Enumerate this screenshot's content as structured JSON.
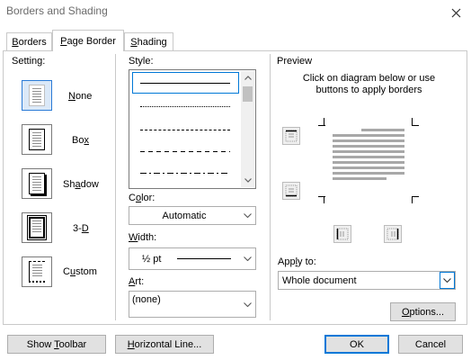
{
  "window": {
    "title": "Borders and Shading"
  },
  "tabs": [
    {
      "label": "Borders",
      "accesskey": "B",
      "rest": "orders"
    },
    {
      "label": "Page Border",
      "accesskey": "P",
      "rest": "age Border"
    },
    {
      "label": "Shading",
      "accesskey": "S",
      "rest": "hading"
    }
  ],
  "setting": {
    "label": "Setting:",
    "items": [
      {
        "label": "None",
        "accesskey": "N",
        "rest": "one"
      },
      {
        "label": "Box",
        "accesskey": "x",
        "pre": "Bo"
      },
      {
        "label": "Shadow",
        "accesskey": "a",
        "pre": "Sh",
        "rest": "dow"
      },
      {
        "label": "3-D",
        "accesskey": "D",
        "pre": "3-"
      },
      {
        "label": "Custom",
        "accesskey": "u",
        "pre": "C",
        "rest": "stom"
      }
    ],
    "selected": "None"
  },
  "style": {
    "label": "Style:",
    "items": [
      "solid",
      "dotted",
      "dashed-small",
      "dashed",
      "dash-dot"
    ],
    "selected": "solid"
  },
  "color": {
    "label": "Color:",
    "value": "Automatic"
  },
  "width": {
    "label": "Width:",
    "value": "½ pt"
  },
  "art": {
    "label": "Art:",
    "value": "(none)"
  },
  "preview": {
    "label": "Preview",
    "hint_line1": "Click on diagram below or use",
    "hint_line2": "buttons to apply borders"
  },
  "apply_to": {
    "label": "Apply to:",
    "value": "Whole document"
  },
  "buttons": {
    "options": "Options...",
    "show_toolbar": "Show Toolbar",
    "horizontal_line": "Horizontal Line...",
    "ok": "OK",
    "cancel": "Cancel"
  },
  "colors": {
    "selection_accent": "#0078d7",
    "selected_fill": "#dbe9f8"
  }
}
